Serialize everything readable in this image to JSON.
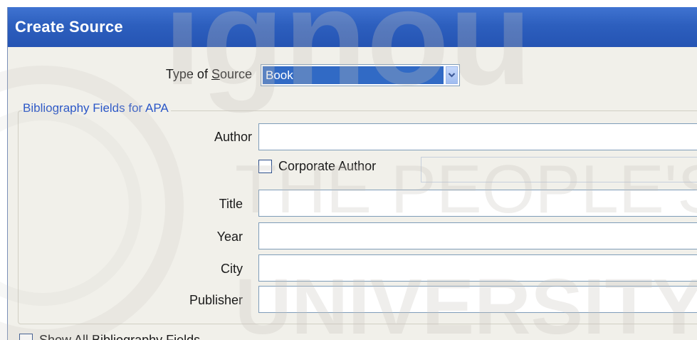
{
  "dialog": {
    "title": "Create Source"
  },
  "source_type": {
    "label_prefix": "Type of ",
    "label_accel": "S",
    "label_suffix": "ource",
    "selected": "Book"
  },
  "group": {
    "title": "Bibliography Fields for APA"
  },
  "fields": {
    "author": {
      "label": "Author",
      "value": ""
    },
    "corporate_author": {
      "label": "Corporate Author",
      "checked": false
    },
    "title": {
      "label": "Title",
      "value": ""
    },
    "year": {
      "label": "Year",
      "value": ""
    },
    "city": {
      "label": "City",
      "value": ""
    },
    "publisher": {
      "label": "Publisher",
      "value": ""
    }
  },
  "show_all": {
    "label": "Show All Bibliography Fields",
    "checked": false
  },
  "watermark": {
    "line1": "ignou",
    "line2": "THE PEOPLE'S",
    "line3": "UNIVERSITY"
  },
  "colors": {
    "titlebar": "#2d5fbe",
    "selection": "#316ac5",
    "group_title": "#2a56c7",
    "dialog_bg": "#f1f0ea"
  }
}
